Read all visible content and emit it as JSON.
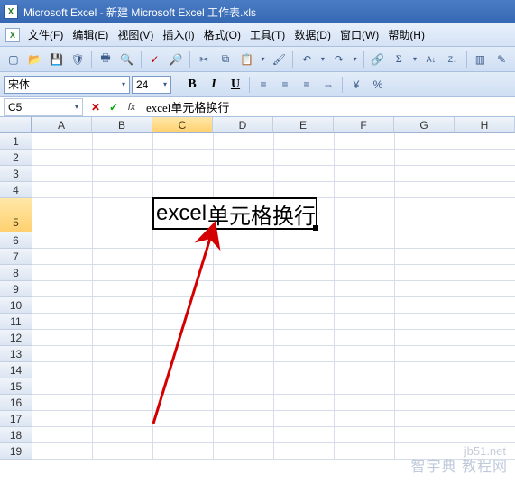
{
  "title": "Microsoft Excel - 新建 Microsoft Excel 工作表.xls",
  "menu": {
    "file": "文件(F)",
    "edit": "编辑(E)",
    "view": "视图(V)",
    "insert": "插入(I)",
    "format": "格式(O)",
    "tools": "工具(T)",
    "data": "数据(D)",
    "window": "窗口(W)",
    "help": "帮助(H)"
  },
  "fmt": {
    "font_name": "宋体",
    "font_size": "24",
    "bold": "B",
    "italic": "I",
    "underline": "U"
  },
  "formula_bar": {
    "name_box": "C5",
    "cancel": "✕",
    "enter": "✓",
    "fx": "fx",
    "value": "excel单元格换行"
  },
  "columns": [
    "A",
    "B",
    "C",
    "D",
    "E",
    "F",
    "G",
    "H"
  ],
  "rows": [
    "1",
    "2",
    "3",
    "4",
    "5",
    "6",
    "7",
    "8",
    "9",
    "10",
    "11",
    "12",
    "13",
    "14",
    "15",
    "16",
    "17",
    "18",
    "19"
  ],
  "active": {
    "col": "C",
    "row": "5",
    "display_text": "excel单元格换行",
    "text_before_caret": "excel",
    "text_after_caret": "单元格换行"
  },
  "icons": {
    "new": "▢",
    "open": "📂",
    "save": "💾",
    "print": "🖶",
    "preview": "🔍",
    "cut": "✂",
    "copy": "⧉",
    "paste": "📋",
    "undo": "↶",
    "redo": "↷",
    "sort_asc": "A↓",
    "sort_desc": "Z↓",
    "chart": "▥",
    "drop": "▾"
  },
  "watermark": {
    "line1": "智宇典 教程网",
    "line2": "jb51.net"
  }
}
